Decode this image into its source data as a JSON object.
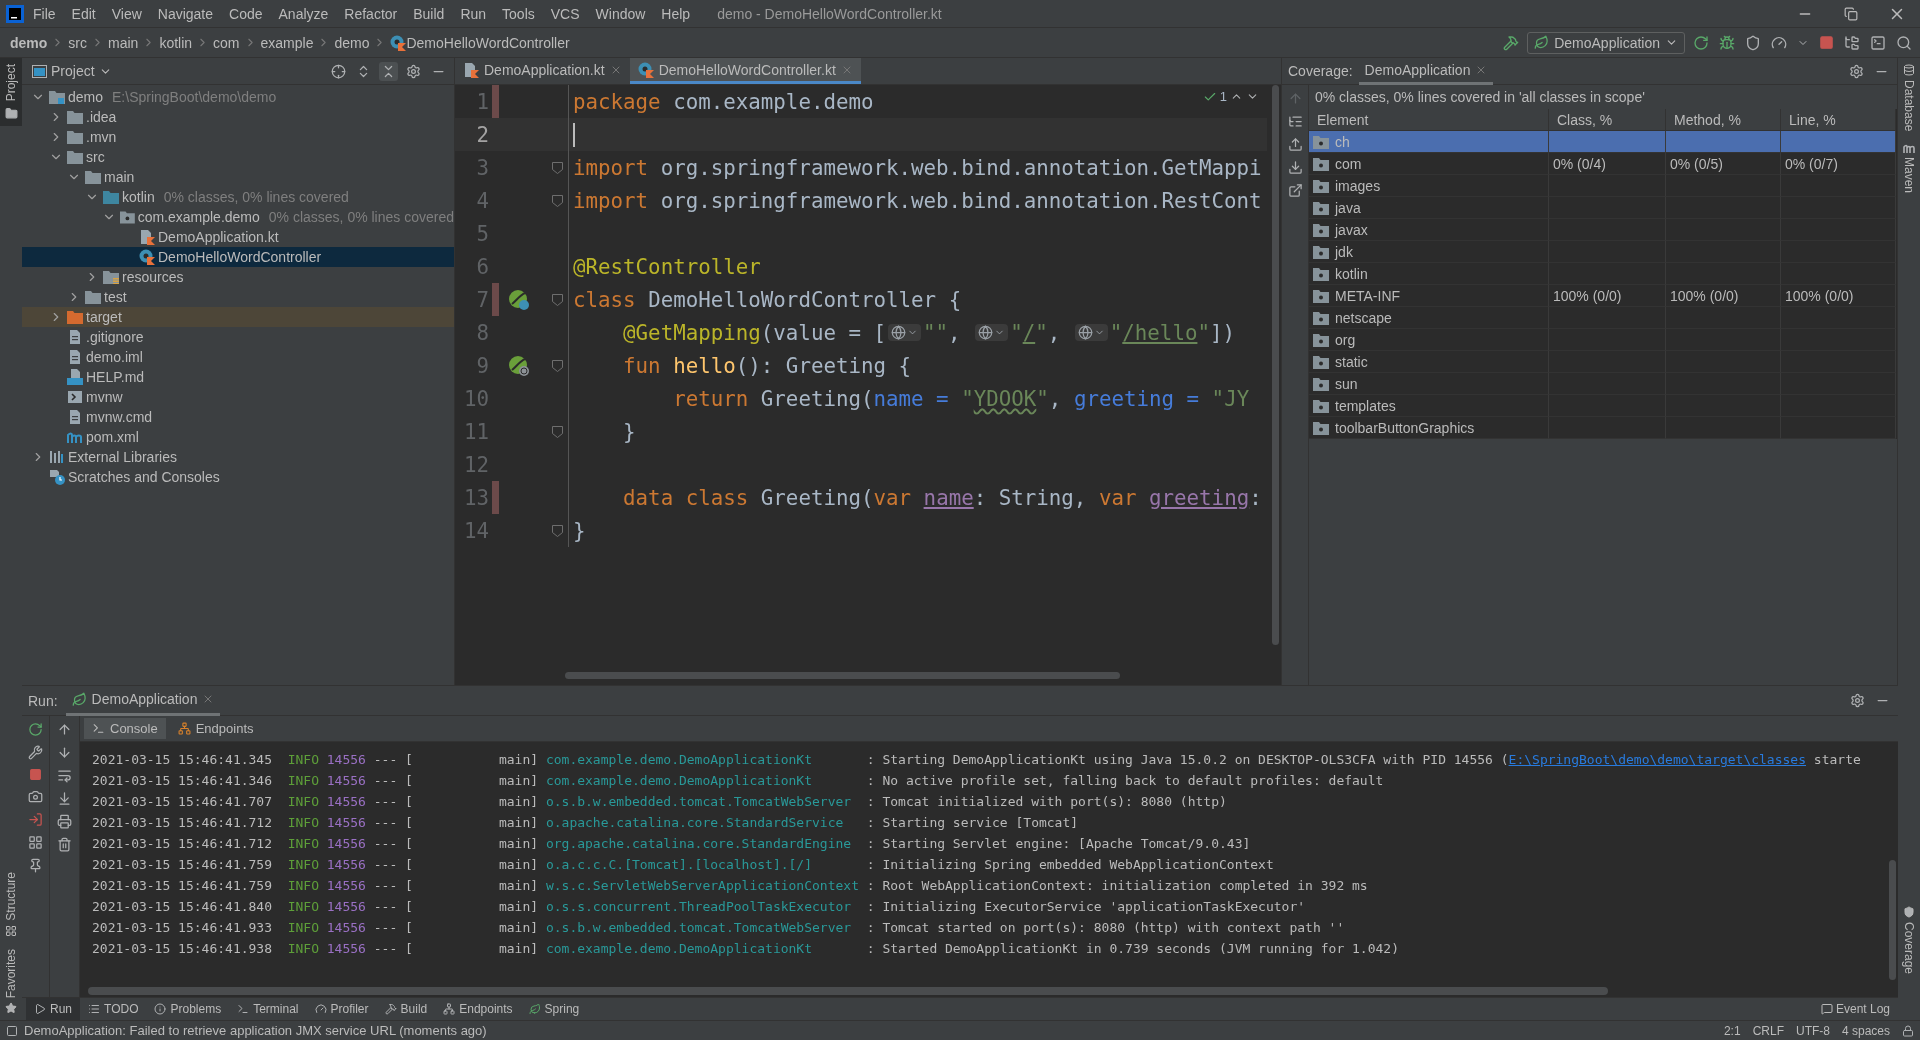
{
  "menu_bar": {
    "items": [
      "File",
      "Edit",
      "View",
      "Navigate",
      "Code",
      "Analyze",
      "Refactor",
      "Build",
      "Run",
      "Tools",
      "VCS",
      "Window",
      "Help"
    ],
    "title": "demo - DemoHelloWordController.kt"
  },
  "breadcrumbs": [
    "demo",
    "src",
    "main",
    "kotlin",
    "com",
    "example",
    "demo",
    "DemoHelloWordController"
  ],
  "toolbar": {
    "run_config": "DemoApplication"
  },
  "left_strip": {
    "tabs": [
      {
        "label": "Project",
        "selected": true
      }
    ],
    "bottom_labels": [
      "Structure",
      "Favorites"
    ]
  },
  "right_strip": [
    "Database",
    "Maven",
    "Coverage"
  ],
  "project": {
    "title": "Project",
    "tree": [
      {
        "label": "demo",
        "kind": "module",
        "note": "E:\\SpringBoot\\demo\\demo",
        "expanded": true,
        "selected": false,
        "children": [
          {
            "label": ".idea",
            "kind": "folder",
            "expanded": false,
            "selected": false
          },
          {
            "label": ".mvn",
            "kind": "folder",
            "expanded": false,
            "selected": false
          },
          {
            "label": "src",
            "kind": "folder",
            "expanded": true,
            "selected": false,
            "children": [
              {
                "label": "main",
                "kind": "folder",
                "expanded": true,
                "selected": false,
                "children": [
                  {
                    "label": "kotlin",
                    "kind": "source",
                    "note": "0% classes, 0% lines covered",
                    "expanded": true,
                    "selected": false,
                    "children": [
                      {
                        "label": "com.example.demo",
                        "kind": "package",
                        "note": "0% classes, 0% lines covered",
                        "expanded": true,
                        "selected": false,
                        "children": [
                          {
                            "label": "DemoApplication.kt",
                            "kind": "kotlin-file",
                            "selected": false
                          },
                          {
                            "label": "DemoHelloWordController",
                            "kind": "kotlin-class",
                            "selected": true
                          }
                        ]
                      }
                    ]
                  },
                  {
                    "label": "resources",
                    "kind": "resources",
                    "expanded": false,
                    "selected": false
                  }
                ]
              },
              {
                "label": "test",
                "kind": "folder",
                "expanded": false,
                "selected": false
              }
            ]
          },
          {
            "label": "target",
            "kind": "excluded",
            "expanded": false,
            "selected": false
          },
          {
            "label": ".gitignore",
            "kind": "file",
            "selected": false
          },
          {
            "label": "demo.iml",
            "kind": "file",
            "selected": false
          },
          {
            "label": "HELP.md",
            "kind": "md",
            "selected": false
          },
          {
            "label": "mvnw",
            "kind": "script",
            "selected": false
          },
          {
            "label": "mvnw.cmd",
            "kind": "file",
            "selected": false
          },
          {
            "label": "pom.xml",
            "kind": "maven",
            "selected": false
          }
        ]
      },
      {
        "label": "External Libraries",
        "kind": "libraries",
        "expanded": false,
        "selected": false
      },
      {
        "label": "Scratches and Consoles",
        "kind": "scratches",
        "selected": false
      }
    ]
  },
  "editor": {
    "tabs": [
      {
        "label": "DemoApplication.kt",
        "kind": "kotlin-file",
        "selected": false
      },
      {
        "label": "DemoHelloWordController.kt",
        "kind": "kotlin-class",
        "selected": true
      }
    ],
    "inspection_count": "1",
    "lines": [
      {
        "number": "1",
        "changed": true,
        "current": false,
        "fold": false,
        "tokens": [
          {
            "text": "package",
            "kind": "keyword"
          },
          {
            "text": " com.example.demo",
            "kind": "plain"
          }
        ]
      },
      {
        "number": "2",
        "changed": false,
        "current": true,
        "fold": false
      },
      {
        "number": "3",
        "changed": false,
        "current": false,
        "fold": true,
        "tokens": [
          {
            "text": "import",
            "kind": "keyword"
          },
          {
            "text": " org.springframework.web.bind.annotation.GetMappi",
            "kind": "plain"
          }
        ]
      },
      {
        "number": "4",
        "changed": false,
        "current": false,
        "fold": true,
        "tokens": [
          {
            "text": "import",
            "kind": "keyword"
          },
          {
            "text": " org.springframework.web.bind.annotation.RestCont",
            "kind": "plain"
          }
        ]
      },
      {
        "number": "5",
        "changed": false,
        "current": false,
        "fold": false
      },
      {
        "number": "6",
        "changed": false,
        "current": false,
        "fold": false,
        "tokens": [
          {
            "text": "@RestController",
            "kind": "annotation"
          }
        ]
      },
      {
        "number": "7",
        "changed": true,
        "current": false,
        "fold": true,
        "gutter": {
          "kind": "bean"
        },
        "tokens": [
          {
            "text": "class",
            "kind": "keyword"
          },
          {
            "text": " DemoHelloWordController {",
            "kind": "plain"
          }
        ]
      },
      {
        "number": "8",
        "changed": false,
        "current": false,
        "fold": false,
        "tokens": [
          {
            "text": "    @GetMapping",
            "kind": "annotation"
          },
          {
            "text": "(value = [",
            "kind": "plain"
          },
          {
            "kind": "inlay"
          },
          {
            "text": "\"\"",
            "kind": "string"
          },
          {
            "text": ", ",
            "kind": "plain"
          },
          {
            "kind": "inlay"
          },
          {
            "text": "\"",
            "kind": "string"
          },
          {
            "text": "/",
            "kind": "string-link"
          },
          {
            "text": "\"",
            "kind": "string"
          },
          {
            "text": ", ",
            "kind": "plain"
          },
          {
            "kind": "inlay"
          },
          {
            "text": "\"",
            "kind": "string"
          },
          {
            "text": "/hello",
            "kind": "string-link"
          },
          {
            "text": "\"",
            "kind": "string"
          },
          {
            "text": "])",
            "kind": "plain"
          }
        ]
      },
      {
        "number": "9",
        "changed": false,
        "current": false,
        "fold": true,
        "gutter": {
          "kind": "web"
        },
        "tokens": [
          {
            "text": "    fun",
            "kind": "keyword"
          },
          {
            "text": " hello",
            "kind": "function"
          },
          {
            "text": "(): Greeting {",
            "kind": "plain"
          }
        ]
      },
      {
        "number": "10",
        "changed": false,
        "current": false,
        "fold": false,
        "tokens": [
          {
            "text": "        return",
            "kind": "keyword"
          },
          {
            "text": " Greeting(",
            "kind": "plain"
          },
          {
            "text": "name =",
            "kind": "named-arg"
          },
          {
            "text": " \"",
            "kind": "string"
          },
          {
            "text": "YDOOK",
            "kind": "string-typo"
          },
          {
            "text": "\"",
            "kind": "string"
          },
          {
            "text": ", ",
            "kind": "plain"
          },
          {
            "text": "greeting =",
            "kind": "named-arg"
          },
          {
            "text": " \"JY",
            "kind": "string"
          }
        ]
      },
      {
        "number": "11",
        "changed": false,
        "current": false,
        "fold": true,
        "tokens": [
          {
            "text": "    }",
            "kind": "plain"
          }
        ]
      },
      {
        "number": "12",
        "changed": false,
        "current": false,
        "fold": false
      },
      {
        "number": "13",
        "changed": true,
        "current": false,
        "fold": false,
        "tokens": [
          {
            "text": "    data class",
            "kind": "keyword"
          },
          {
            "text": " Greeting(",
            "kind": "plain"
          },
          {
            "text": "var ",
            "kind": "keyword"
          },
          {
            "text": "name",
            "kind": "property"
          },
          {
            "text": ": String, ",
            "kind": "plain"
          },
          {
            "text": "var ",
            "kind": "keyword"
          },
          {
            "text": "greeting",
            "kind": "property"
          },
          {
            "text": ":",
            "kind": "plain"
          }
        ]
      },
      {
        "number": "14",
        "changed": false,
        "current": false,
        "fold": true,
        "tokens": [
          {
            "text": "}",
            "kind": "plain"
          }
        ]
      }
    ]
  },
  "coverage": {
    "label": "Coverage:",
    "tab": "DemoApplication",
    "summary": "0% classes, 0% lines covered in 'all classes in scope'",
    "columns": [
      "Element",
      "Class, %",
      "Method, %",
      "Line, %"
    ],
    "rows": [
      {
        "element": "ch",
        "selected": true
      },
      {
        "element": "com",
        "class": "0% (0/4)",
        "method": "0% (0/5)",
        "line": "0% (0/7)",
        "selected": false
      },
      {
        "element": "images",
        "selected": false
      },
      {
        "element": "java",
        "selected": false
      },
      {
        "element": "javax",
        "selected": false
      },
      {
        "element": "jdk",
        "selected": false
      },
      {
        "element": "kotlin",
        "selected": false
      },
      {
        "element": "META-INF",
        "class": "100% (0/0)",
        "method": "100% (0/0)",
        "line": "100% (0/0)",
        "selected": false
      },
      {
        "element": "netscape",
        "selected": false
      },
      {
        "element": "org",
        "selected": false
      },
      {
        "element": "static",
        "selected": false
      },
      {
        "element": "sun",
        "selected": false
      },
      {
        "element": "templates",
        "selected": false
      },
      {
        "element": "toolbarButtonGraphics",
        "selected": false
      }
    ]
  },
  "run": {
    "label": "Run:",
    "tab": "DemoApplication",
    "subtabs": [
      {
        "label": "Console",
        "selected": true
      },
      {
        "label": "Endpoints",
        "selected": false
      }
    ],
    "console": [
      {
        "time": "2021-03-15 15:46:41.345",
        "level": "INFO",
        "pid": "14556",
        "sep": "--- [",
        "thread": "main]",
        "logger": "com.example.demo.DemoApplicationKt",
        "message": ": Starting DemoApplicationKt using Java 15.0.2 on DESKTOP-OLS3CFA with PID 14556 (",
        "link": "E:\\SpringBoot\\demo\\demo\\target\\classes",
        "tail": " starte"
      },
      {
        "time": "2021-03-15 15:46:41.346",
        "level": "INFO",
        "pid": "14556",
        "sep": "--- [",
        "thread": "main]",
        "logger": "com.example.demo.DemoApplicationKt",
        "message": ": No active profile set, falling back to default profiles: default"
      },
      {
        "time": "2021-03-15 15:46:41.707",
        "level": "INFO",
        "pid": "14556",
        "sep": "--- [",
        "thread": "main]",
        "logger": "o.s.b.w.embedded.tomcat.TomcatWebServer",
        "message": ": Tomcat initialized with port(s): 8080 (http)"
      },
      {
        "time": "2021-03-15 15:46:41.712",
        "level": "INFO",
        "pid": "14556",
        "sep": "--- [",
        "thread": "main]",
        "logger": "o.apache.catalina.core.StandardService",
        "message": ": Starting service [Tomcat]"
      },
      {
        "time": "2021-03-15 15:46:41.712",
        "level": "INFO",
        "pid": "14556",
        "sep": "--- [",
        "thread": "main]",
        "logger": "org.apache.catalina.core.StandardEngine",
        "message": ": Starting Servlet engine: [Apache Tomcat/9.0.43]"
      },
      {
        "time": "2021-03-15 15:46:41.759",
        "level": "INFO",
        "pid": "14556",
        "sep": "--- [",
        "thread": "main]",
        "logger": "o.a.c.c.C.[Tomcat].[localhost].[/]",
        "message": ": Initializing Spring embedded WebApplicationContext"
      },
      {
        "time": "2021-03-15 15:46:41.759",
        "level": "INFO",
        "pid": "14556",
        "sep": "--- [",
        "thread": "main]",
        "logger": "w.s.c.ServletWebServerApplicationContext",
        "message": ": Root WebApplicationContext: initialization completed in 392 ms"
      },
      {
        "time": "2021-03-15 15:46:41.840",
        "level": "INFO",
        "pid": "14556",
        "sep": "--- [",
        "thread": "main]",
        "logger": "o.s.s.concurrent.ThreadPoolTaskExecutor",
        "message": ": Initializing ExecutorService 'applicationTaskExecutor'"
      },
      {
        "time": "2021-03-15 15:46:41.933",
        "level": "INFO",
        "pid": "14556",
        "sep": "--- [",
        "thread": "main]",
        "logger": "o.s.b.w.embedded.tomcat.TomcatWebServer",
        "message": ": Tomcat started on port(s): 8080 (http) with context path ''"
      },
      {
        "time": "2021-03-15 15:46:41.938",
        "level": "INFO",
        "pid": "14556",
        "sep": "--- [",
        "thread": "main]",
        "logger": "com.example.demo.DemoApplicationKt",
        "message": ": Started DemoApplicationKt in 0.739 seconds (JVM running for 1.042)"
      }
    ]
  },
  "bottom_tabs": [
    {
      "label": "Run",
      "selected": true
    },
    {
      "label": "TODO",
      "selected": false
    },
    {
      "label": "Problems",
      "selected": false
    },
    {
      "label": "Terminal",
      "selected": false
    },
    {
      "label": "Profiler",
      "selected": false
    },
    {
      "label": "Build",
      "selected": false
    },
    {
      "label": "Endpoints",
      "selected": false
    },
    {
      "label": "Spring",
      "selected": false
    }
  ],
  "event_log": "Event Log",
  "status_bar": {
    "message": "DemoApplication: Failed to retrieve application JMX service URL (moments ago)",
    "items": [
      "2:1",
      "CRLF",
      "UTF-8",
      "4 spaces"
    ]
  }
}
